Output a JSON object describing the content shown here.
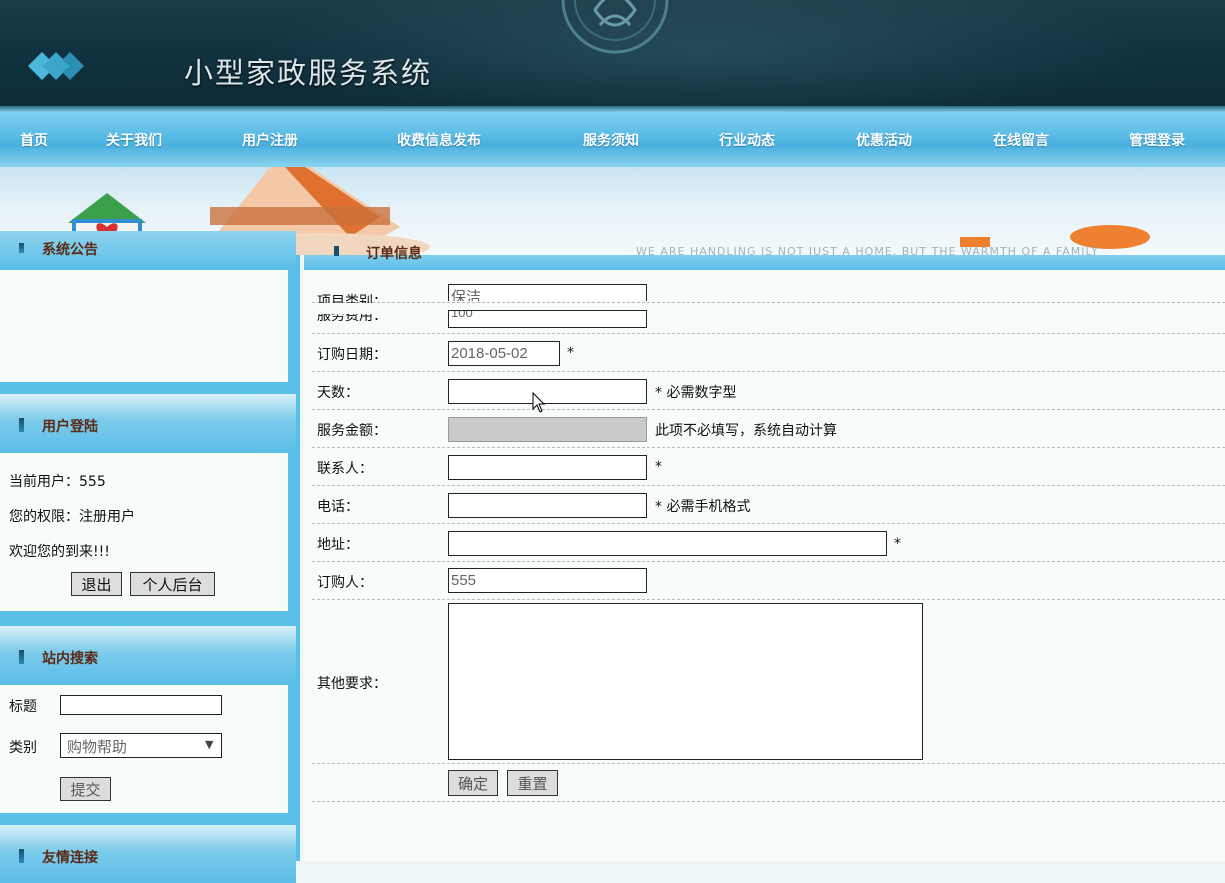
{
  "header": {
    "site_title": "小型家政服务系统"
  },
  "nav": [
    "首页",
    "关于我们",
    "用户注册",
    "收费信息发布",
    "服务须知",
    "行业动态",
    "优惠活动",
    "在线留言",
    "管理登录"
  ],
  "banner": {
    "slogan": "WE ARE HANDLING IS NOT JUST A HOME, BUT THE WARMTH OF A FAMILY"
  },
  "sidebar": {
    "notice_title": "系统公告",
    "login": {
      "title": "用户登陆",
      "current_user": "当前用户：555",
      "role": "您的权限：注册用户",
      "welcome": "欢迎您的到来!!!",
      "logout_label": "退出",
      "backend_label": "个人后台"
    },
    "search": {
      "title": "站内搜索",
      "title_label": "标题",
      "title_value": "",
      "category_label": "类别",
      "category_selected": "购物帮助",
      "submit_label": "提交"
    },
    "links_title": "友情连接"
  },
  "form": {
    "title": "订单信息",
    "fields": {
      "item_category": {
        "label": "项目类别：",
        "value": "保洁"
      },
      "service_fee": {
        "label": "服务费用：",
        "value": "100"
      },
      "order_date": {
        "label": "订购日期：",
        "value": "2018-05-02",
        "mark": "*"
      },
      "days": {
        "label": "天数：",
        "value": "",
        "note": "* 必需数字型"
      },
      "amount": {
        "label": "服务金额：",
        "value": "",
        "note": "此项不必填写，系统自动计算"
      },
      "contact": {
        "label": "联系人：",
        "value": "",
        "mark": "*"
      },
      "phone": {
        "label": "电话：",
        "value": "",
        "note": "* 必需手机格式"
      },
      "address": {
        "label": "地址：",
        "value": "",
        "mark": "*"
      },
      "orderer": {
        "label": "订购人：",
        "value": "555"
      },
      "other": {
        "label": "其他要求：",
        "value": ""
      }
    },
    "confirm_label": "确定",
    "reset_label": "重置"
  }
}
